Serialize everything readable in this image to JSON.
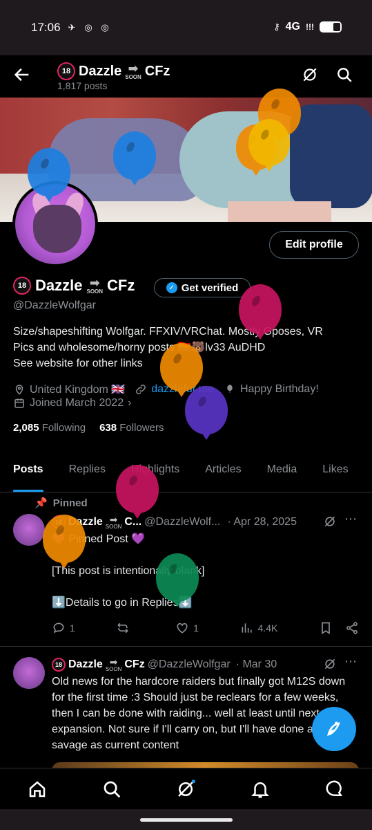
{
  "status_bar": {
    "time": "17:06",
    "network": "4G",
    "signal": "!!!",
    "app_icons": [
      "telegram-icon",
      "whatsapp-icon",
      "whatsapp-icon"
    ]
  },
  "top_bar": {
    "title": "Dazzle",
    "title_suffix": "CFz",
    "post_count": "1,817 posts"
  },
  "profile": {
    "age_badge": "18",
    "display_name": "Dazzle",
    "name_suffix": "CFz",
    "soon_label": "SOON",
    "edit_label": "Edit profile",
    "verify_label": "Get verified",
    "handle": "@DazzleWolfgar",
    "bio_line1": "Size/shapeshifting Wolfgar. FFXIV/VRChat. Mostly Gposes, VR",
    "bio_line2": "Pics and wholesome/horny posts 🏳️‍🌈🐻lv33 AuDHD",
    "bio_line3": "See website for other links",
    "location": "United Kingdom 🇬🇧",
    "website": "dazzlefur.me",
    "birthday": "Happy Birthday!",
    "joined": "Joined March 2022",
    "following_count": "2,085",
    "following_label": "Following",
    "followers_count": "638",
    "followers_label": "Followers"
  },
  "tabs": [
    "Posts",
    "Replies",
    "Highlights",
    "Articles",
    "Media",
    "Likes"
  ],
  "posts": [
    {
      "pinned_label": "Pinned",
      "author": "Dazzle",
      "author_suffix": "C...",
      "handle": "@DazzleWolf...",
      "date": "· Apr 28, 2025",
      "line1": "💜 Pinned Post 💜",
      "line2": "[This post is intentionally blank]",
      "line3": "⬇️Details to go in Replies⬇️",
      "replies": "1",
      "reposts": "",
      "likes": "1",
      "views": "4.4K"
    },
    {
      "author": "Dazzle",
      "author_suffix": "CFz",
      "handle": "@DazzleWolfgar",
      "date": "· Mar 30",
      "text": "Old news for the hardcore raiders but finally got M12S down for the  first time :3 Should just be reclears for a few weeks, then I can be done with raiding... well at least until next expansion. Not sure if I'll carry on, but I'll have done all of dt savage as current content"
    }
  ],
  "colors": {
    "accent": "#1d9bf0",
    "muted": "#8b8f94",
    "divider": "#2f3336",
    "balloon_orange": "#f08a00",
    "balloon_blue": "#1d7fe0",
    "balloon_magenta": "#c81460",
    "balloon_purple": "#5a35c6",
    "balloon_green": "#0d8a55",
    "balloon_yellow": "#f2b800"
  },
  "nav_icons": [
    "home-icon",
    "search-icon",
    "grok-icon",
    "notifications-icon",
    "messages-icon"
  ]
}
